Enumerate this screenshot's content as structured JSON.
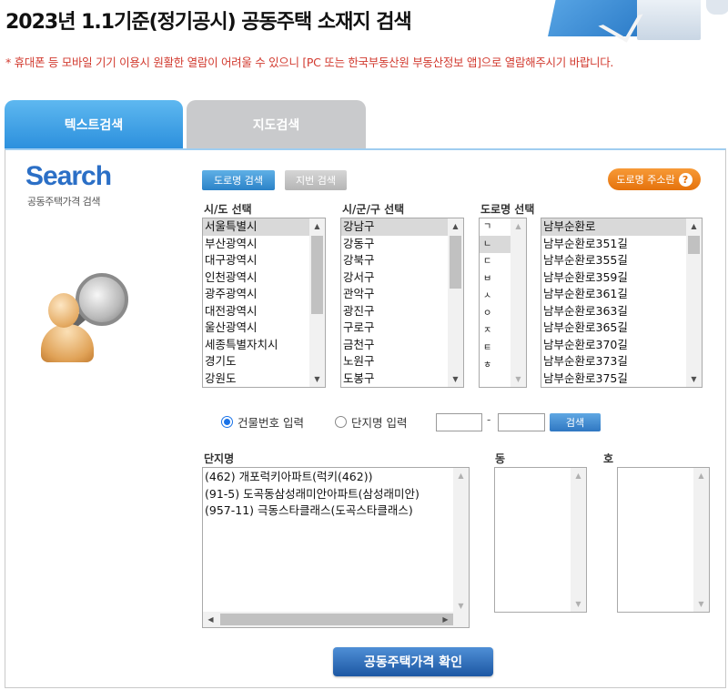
{
  "page": {
    "title": "2023년 1.1기준(정기공시) 공동주택 소재지 검색",
    "notice": "* 휴대폰 등 모바일 기기 이용시 원활한 열람이 어려울 수 있으니 [PC 또는 한국부동산원 부동산정보 앱]으로 열람해주시기 바랍니다."
  },
  "tabs": [
    {
      "label": "텍스트검색",
      "active": true
    },
    {
      "label": "지도검색",
      "active": false
    }
  ],
  "logo": {
    "title": "Search",
    "subtitle": "공동주택가격 검색"
  },
  "search_mode": {
    "road_label": "도로명 검색",
    "lot_label": "지번 검색",
    "guide_label": "도로명 주소란",
    "guide_icon": "question-icon",
    "guide_icon_glyph": "?"
  },
  "columns": {
    "sido": {
      "label": "시/도 선택",
      "selected": "서울특별시",
      "items": [
        "서울특별시",
        "부산광역시",
        "대구광역시",
        "인천광역시",
        "광주광역시",
        "대전광역시",
        "울산광역시",
        "세종특별자치시",
        "경기도",
        "강원도"
      ]
    },
    "sigungu": {
      "label": "시/군/구 선택",
      "selected": "강남구",
      "items": [
        "강남구",
        "강동구",
        "강북구",
        "강서구",
        "관악구",
        "광진구",
        "구로구",
        "금천구",
        "노원구",
        "도봉구"
      ]
    },
    "initial": {
      "label": "도로명 선택",
      "selected": "ㄴ",
      "items": [
        "ㄱ",
        "ㄴ",
        "ㄷ",
        "ㅂ",
        "ㅅ",
        "ㅇ",
        "ㅈ",
        "ㅌ",
        "ㅎ"
      ]
    },
    "road": {
      "selected": "남부순환로",
      "items": [
        "남부순환로",
        "남부순환로351길",
        "남부순환로355길",
        "남부순환로359길",
        "남부순환로361길",
        "남부순환로363길",
        "남부순환로365길",
        "남부순환로370길",
        "남부순환로373길",
        "남부순환로375길"
      ]
    }
  },
  "input_mode": {
    "building_no_label": "건물번호 입력",
    "complex_name_label": "단지명 입력",
    "selected": "building_no",
    "main_no": "",
    "sub_no": "",
    "dash": "-",
    "search_label": "검색"
  },
  "results": {
    "complex_label": "단지명",
    "dong_label": "동",
    "ho_label": "호",
    "complexes": [
      "(462) 개포럭키아파트(럭키(462))",
      "(91-5) 도곡동삼성래미안아파트(삼성래미안)",
      "(957-11) 극동스타클래스(도곡스타클래스)"
    ],
    "dong": [],
    "ho": []
  },
  "confirm_label": "공동주택가격 확인",
  "colors": {
    "accent": "#2b8fdd",
    "notice": "#d23a2f",
    "guide": "#e5720c",
    "confirm": "#1c57a3"
  }
}
